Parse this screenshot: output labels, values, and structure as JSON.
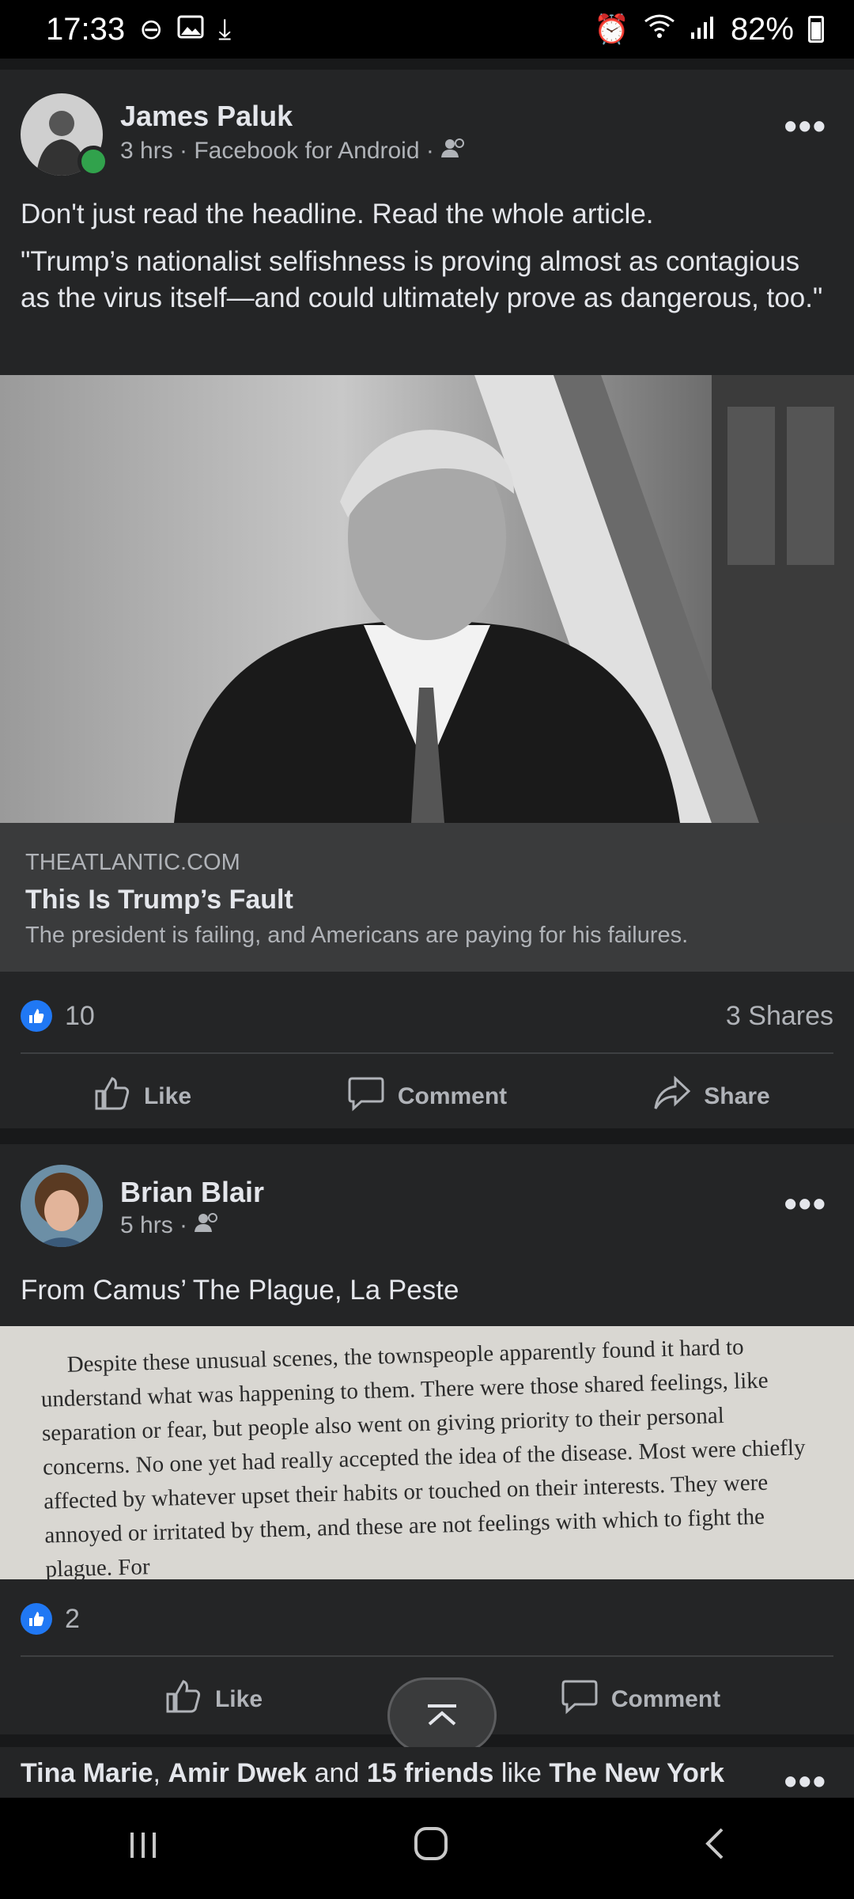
{
  "status_bar": {
    "time": "17:33",
    "battery": "82%",
    "icons": [
      "do-not-disturb-icon",
      "image-icon",
      "download-icon",
      "alarm-icon",
      "wifi-icon",
      "signal-icon",
      "battery-icon"
    ]
  },
  "posts": [
    {
      "author": "James Paluk",
      "meta": "3 hrs · Facebook for Android ·",
      "audience_icon": "friends-icon",
      "text_lines": [
        "Don't just read the headline. Read the whole article.",
        "\"Trump’s nationalist selfishness is proving almost as contagious as the virus itself—and could ultimately prove as dangerous, too.\""
      ],
      "link": {
        "domain": "THEATLANTIC.COM",
        "title": "This Is Trump’s Fault",
        "description": "The president is failing, and Americans are paying for his failures."
      },
      "likes": "10",
      "shares": "3 Shares",
      "actions": [
        "Like",
        "Comment",
        "Share"
      ]
    },
    {
      "author": "Brian Blair",
      "meta": "5 hrs ·",
      "audience_icon": "friends-icon",
      "text": "From Camus’ The Plague, La Peste",
      "book_text": "Despite these unusual scenes, the townspeople apparently found it hard to understand what was happening to them. There were those shared feelings, like separation or fear, but people also went on giving priority to their personal concerns. No one yet had really accepted the idea of the disease. Most were chiefly affected by whatever upset their habits or touched on their interests. They were annoyed or irritated by them, and these are not feelings with which to fight the plague. For",
      "likes": "2",
      "actions": [
        "Like",
        "Comment"
      ]
    }
  ],
  "suggestion": {
    "name1": "Tina Marie",
    "sep1": ", ",
    "name2": "Amir Dwek",
    "and": " and ",
    "friends": "15 friends",
    "like": " like ",
    "page": "The New York"
  },
  "colors": {
    "background": "#18191a",
    "card": "#242526",
    "accent": "#2078f4",
    "text": "#e4e6eb",
    "secondary": "#b0b3b8"
  }
}
